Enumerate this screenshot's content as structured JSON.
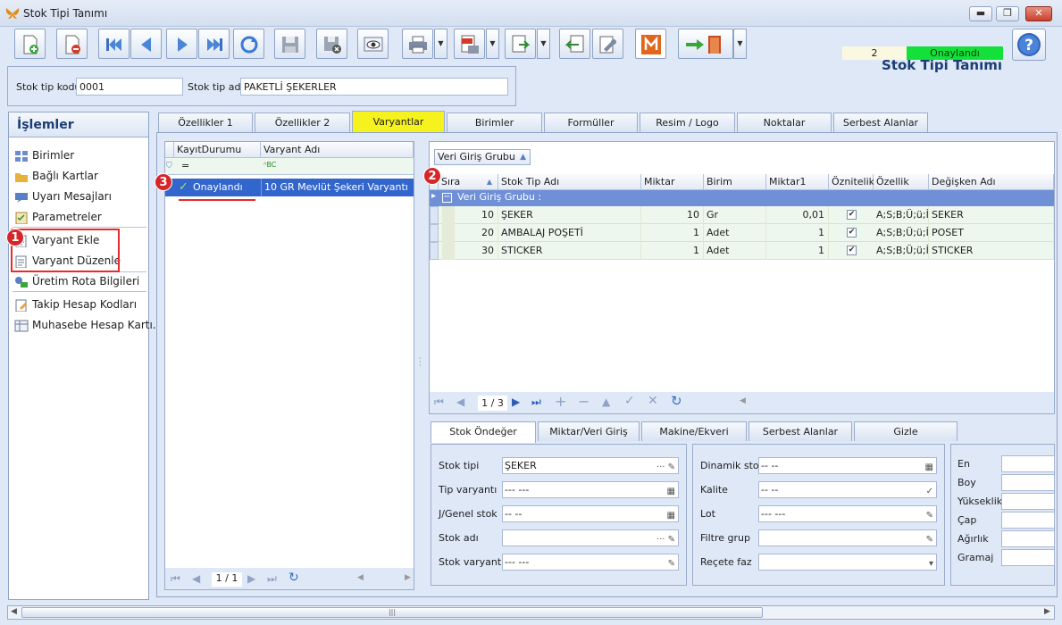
{
  "window": {
    "title": "Stok Tipi Tanımı",
    "min": "▬",
    "max": "❐",
    "close": "✕"
  },
  "header": {
    "title": "Stok Tipi Tanımı",
    "count": "2",
    "status": "Onaylandı"
  },
  "codes": {
    "code_label": "Stok tip kodu",
    "code_value": "0001",
    "name_label": "Stok tip adı",
    "name_value": "PAKETLİ ŞEKERLER"
  },
  "left": {
    "title": "İşlemler",
    "items": [
      {
        "label": "Birimler"
      },
      {
        "label": "Bağlı Kartlar"
      },
      {
        "label": "Uyarı Mesajları"
      },
      {
        "label": "Parametreler"
      },
      {
        "label": "Varyant Ekle"
      },
      {
        "label": "Varyant Düzenle"
      },
      {
        "label": "Üretim Rota Bilgileri"
      },
      {
        "label": "Takip Hesap Kodları"
      },
      {
        "label": "Muhasebe Hesap Kartı..."
      }
    ],
    "badge": "1"
  },
  "tabs": [
    "Özellikler 1",
    "Özellikler 2",
    "Varyantlar",
    "Birimler",
    "Formüller",
    "Resim / Logo",
    "Noktalar",
    "Serbest Alanlar"
  ],
  "grid1": {
    "headers": [
      "KayıtDurumu",
      "Varyant Adı"
    ],
    "filter_symbol": "=",
    "filter_abc": "ᴬBC",
    "row": {
      "status": "Onaylandı",
      "name": "10 GR Mevlüt Şekeri Varyantı"
    },
    "badge": "3",
    "page": "1 / 1"
  },
  "grid2": {
    "group_button": "Veri Giriş Grubu",
    "badge": "2",
    "headers": [
      "Sıra",
      "Stok Tip Adı",
      "Miktar",
      "Birim",
      "Miktar1",
      "Öznitelik",
      "Özellik",
      "Değişken Adı"
    ],
    "group_row": "Veri Giriş Grubu :",
    "rows": [
      {
        "sira": "10",
        "ad": "ŞEKER",
        "miktar": "10",
        "birim": "Gr",
        "miktar1": "0,01",
        "oz": "A;S;B;Ü;ü;İ",
        "degisken": "SEKER"
      },
      {
        "sira": "20",
        "ad": "AMBALAJ POŞETİ",
        "miktar": "1",
        "birim": "Adet",
        "miktar1": "1",
        "oz": "A;S;B;Ü;ü;İ",
        "degisken": "POSET"
      },
      {
        "sira": "30",
        "ad": "STICKER",
        "miktar": "1",
        "birim": "Adet",
        "miktar1": "1",
        "oz": "A;S;B;Ü;ü;İ",
        "degisken": "STICKER"
      }
    ],
    "page": "1 / 3"
  },
  "subtabs": [
    "Stok Öndeğer",
    "Miktar/Veri Giriş",
    "Makine/Ekveri",
    "Serbest Alanlar",
    "Gizle"
  ],
  "form1": [
    {
      "label": "Stok tipi",
      "value": "ŞEKER",
      "btn": "··· ✎"
    },
    {
      "label": "Tip varyantı",
      "value": "--- ---",
      "btn": "▦"
    },
    {
      "label": "J/Genel stok",
      "value": "-- --",
      "btn": "▦"
    },
    {
      "label": "Stok adı",
      "value": "",
      "btn": "··· ✎"
    },
    {
      "label": "Stok varyantı",
      "value": "--- ---",
      "btn": "✎"
    }
  ],
  "form2": [
    {
      "label": "Dinamik stok",
      "value": "-- --",
      "btn": "▦"
    },
    {
      "label": "Kalite",
      "value": "-- --",
      "btn": "✓"
    },
    {
      "label": "Lot",
      "value": "--- ---",
      "btn": "✎"
    },
    {
      "label": "Filtre grup",
      "value": "",
      "btn": "✎"
    },
    {
      "label": "Reçete faz",
      "value": "",
      "btn": "▾"
    }
  ],
  "form3": [
    "En",
    "Boy",
    "Yükseklik",
    "Çap",
    "Ağırlık",
    "Gramaj"
  ],
  "scroll": {
    "grip": "|||"
  }
}
